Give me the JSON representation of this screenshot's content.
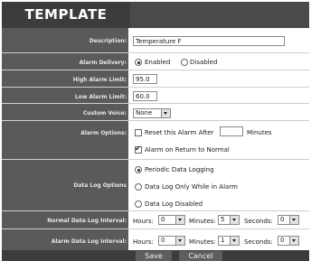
{
  "title": "TEMPLATE",
  "fields": {
    "description": {
      "label": "Description:",
      "value": "Temperature F"
    },
    "alarm_delivery": {
      "label": "Alarm Delivery:",
      "opt1": "Enabled",
      "opt2": "Disabled",
      "selected": "Enabled"
    },
    "high_alarm": {
      "label": "High Alarm Limit:",
      "value": "95.0"
    },
    "low_alarm": {
      "label": "Low Alarm Limit:",
      "value": "60.0"
    },
    "custom_voice": {
      "label": "Custom Voice:",
      "value": "None"
    },
    "alarm_options": {
      "label": "Alarm Options:",
      "reset_text": "Reset this Alarm After",
      "minutes_text": "Minutes",
      "return_text": "Alarm on Return to Normal",
      "reset_checked": false,
      "return_checked": true
    },
    "data_log": {
      "label": "Data Log Options",
      "opt1": "Periodic Data Logging",
      "opt2": "Data Log Only While in Alarm",
      "opt3": "Data Log Disabled",
      "selected": "Periodic Data Logging"
    },
    "normal_interval": {
      "label": "Normal Data Log Interval:",
      "hours_label": "Hours:",
      "hours": "0",
      "minutes_label": "Minutes:",
      "minutes": "5",
      "seconds_label": "Seconds:",
      "seconds": "0"
    },
    "alarm_interval": {
      "label": "Alarm Data Log Interval:",
      "hours_label": "Hours:",
      "hours": "0",
      "minutes_label": "Minutes:",
      "minutes": "1",
      "seconds_label": "Seconds:",
      "seconds": "0"
    }
  },
  "buttons": {
    "save": "Save",
    "cancel": "Cancel"
  }
}
